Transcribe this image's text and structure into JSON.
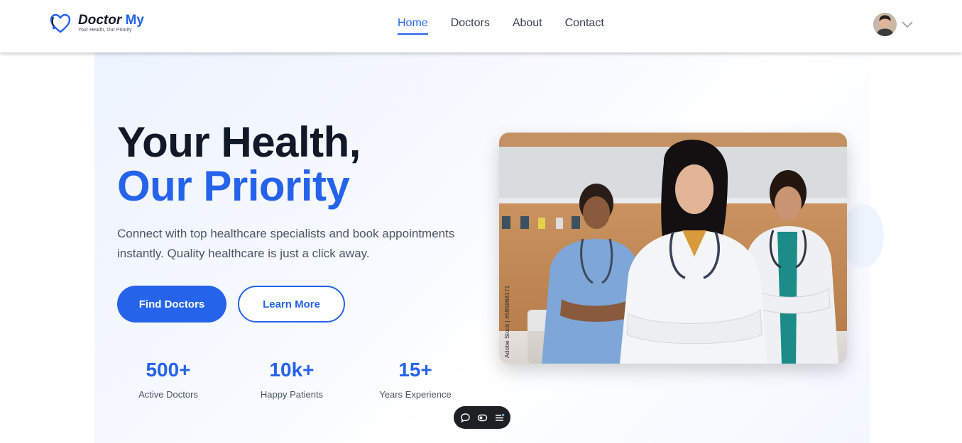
{
  "brand": {
    "name_main": "Doctor",
    "name_accent": "My",
    "tagline": "Your Health, Our Priority",
    "color": "#2563eb"
  },
  "nav": {
    "items": [
      {
        "label": "Home",
        "active": true
      },
      {
        "label": "Doctors",
        "active": false
      },
      {
        "label": "About",
        "active": false
      },
      {
        "label": "Contact",
        "active": false
      }
    ]
  },
  "profile": {
    "avatar_icon": "user-avatar",
    "menu_icon": "chevron-down-icon"
  },
  "hero": {
    "title_line1": "Your Health,",
    "title_line2": "Our Priority",
    "description": "Connect with top healthcare specialists and book appointments instantly. Quality healthcare is just a click away.",
    "primary_button": "Find Doctors",
    "secondary_button": "Learn More",
    "image_watermark": "Adobe Stock | #595968171"
  },
  "stats": [
    {
      "value": "500+",
      "label": "Active Doctors"
    },
    {
      "value": "10k+",
      "label": "Happy Patients"
    },
    {
      "value": "15+",
      "label": "Years Experience"
    }
  ],
  "toolbar": {
    "icons": [
      "chat-icon",
      "toggle-icon",
      "menu-list-icon"
    ]
  }
}
